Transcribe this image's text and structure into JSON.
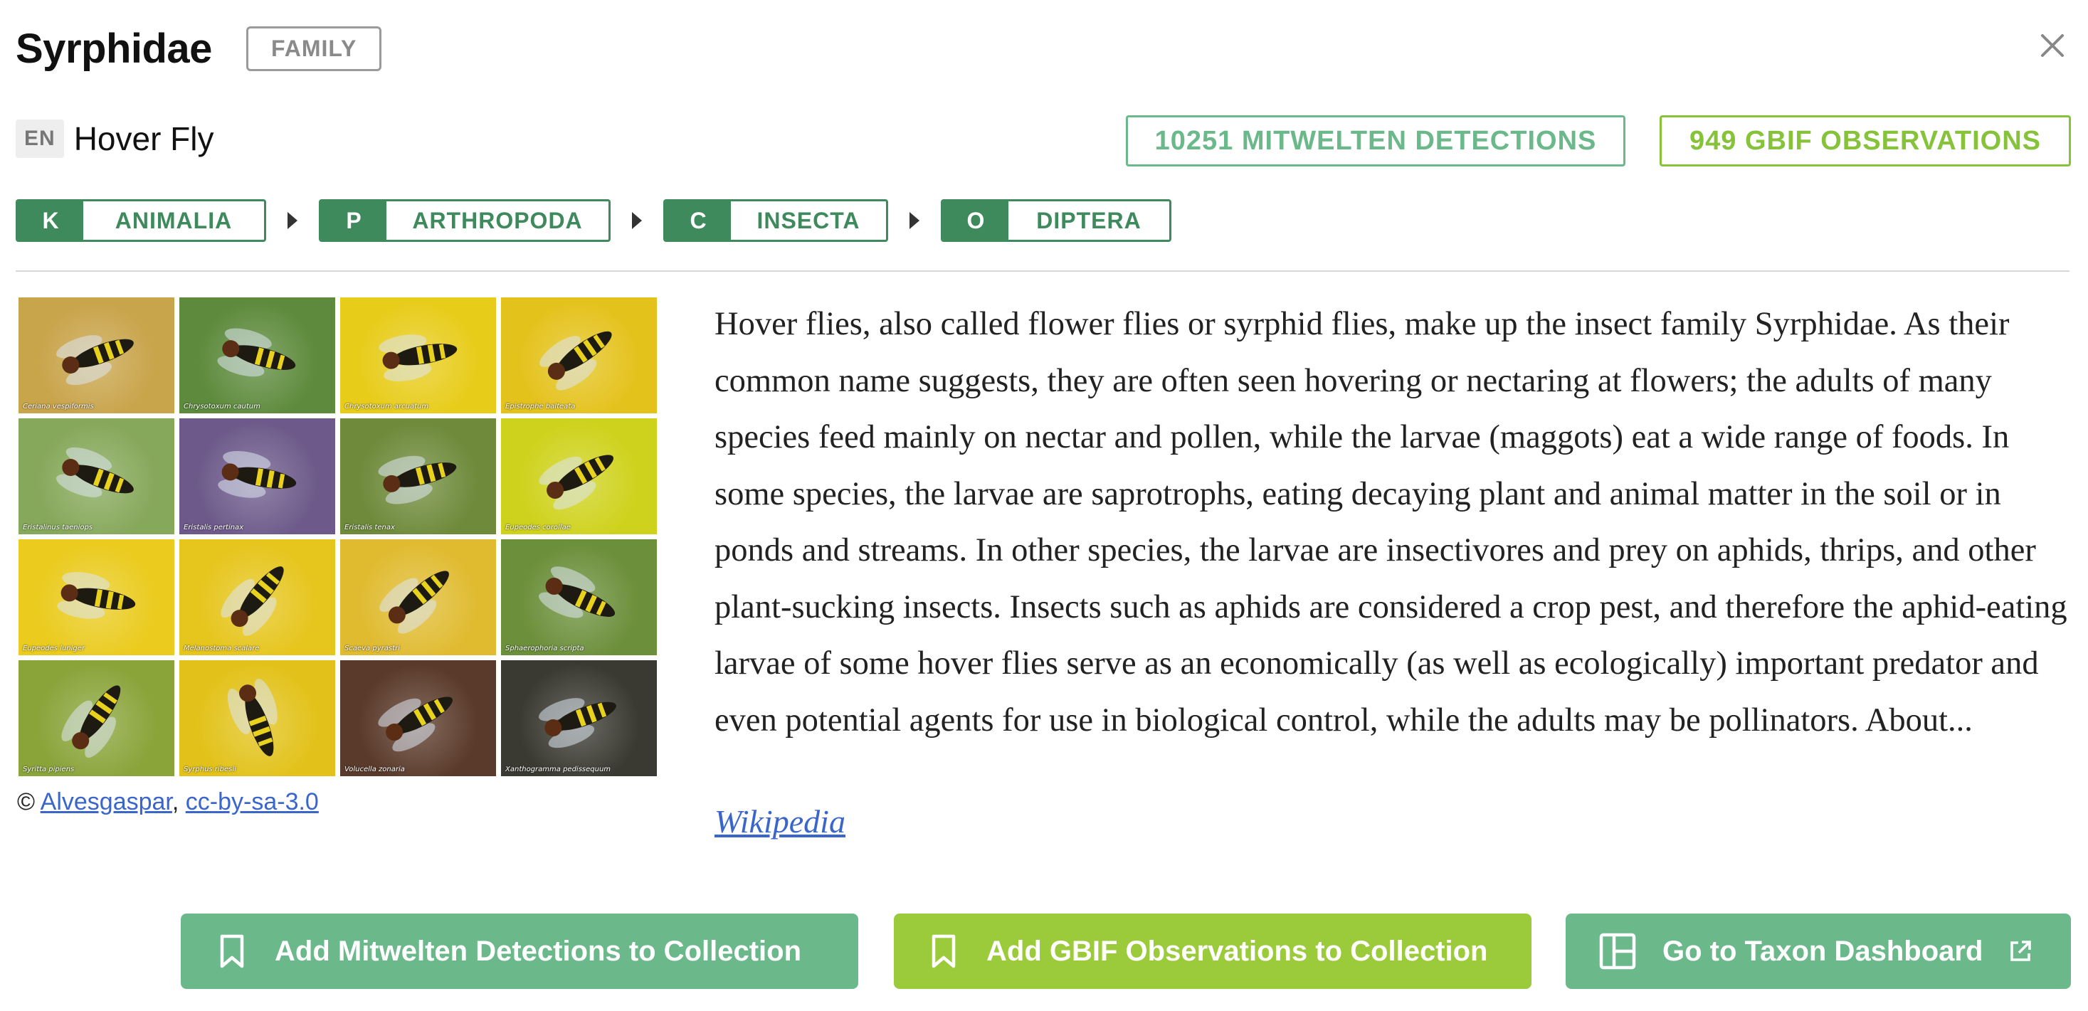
{
  "header": {
    "title": "Syrphidae",
    "rank": "FAMILY",
    "close_icon": "close-icon"
  },
  "common_name": {
    "lang": "EN",
    "name": "Hover Fly"
  },
  "counts": {
    "mitwelten": "10251 MITWELTEN DETECTIONS",
    "gbif": "949 GBIF OBSERVATIONS"
  },
  "taxonomy": [
    {
      "letter": "K",
      "name": "ANIMALIA"
    },
    {
      "letter": "P",
      "name": "ARTHROPODA"
    },
    {
      "letter": "C",
      "name": "INSECTA"
    },
    {
      "letter": "O",
      "name": "DIPTERA"
    }
  ],
  "gallery": [
    {
      "caption": "Ceriana vespiformis",
      "bg": "#c8a44a"
    },
    {
      "caption": "Chrysotoxum cautum",
      "bg": "#5d8a3c"
    },
    {
      "caption": "Chrysotoxum arcuatum",
      "bg": "#e8cc1a"
    },
    {
      "caption": "Epistrophe balteata",
      "bg": "#e4c21c"
    },
    {
      "caption": "Eristalinus taeniops",
      "bg": "#86a85a"
    },
    {
      "caption": "Eristalis pertinax",
      "bg": "#6d5a8a"
    },
    {
      "caption": "Eristalis tenax",
      "bg": "#6e8a3a"
    },
    {
      "caption": "Eupeodes corollae",
      "bg": "#cfd21c"
    },
    {
      "caption": "Eupeodes luniger",
      "bg": "#eacb1e"
    },
    {
      "caption": "Melanostoma scalare",
      "bg": "#e6c51c"
    },
    {
      "caption": "Scaeva pyrastri",
      "bg": "#e0bb30"
    },
    {
      "caption": "Sphaerophoria scripta",
      "bg": "#6b8f3a"
    },
    {
      "caption": "Syritta pipiens",
      "bg": "#8aa43a"
    },
    {
      "caption": "Syrphus ribesii",
      "bg": "#e2c21a"
    },
    {
      "caption": "Volucella zonaria",
      "bg": "#5a3a2a"
    },
    {
      "caption": "Xanthogramma pedissequum",
      "bg": "#3a3a32"
    }
  ],
  "credit": {
    "prefix": "©",
    "author": "Alvesgaspar",
    "license": "cc-by-sa-3.0",
    "comma": ","
  },
  "description": "Hover flies, also called flower flies or syrphid flies, make up the insect family Syrphidae. As their common name suggests, they are often seen hovering or nectaring at flowers; the adults of many species feed mainly on nectar and pollen, while the larvae (maggots) eat a wide range of foods. In some species, the larvae are saprotrophs, eating decaying plant and animal matter in the soil or in ponds and streams. In other species, the larvae are insectivores and prey on aphids, thrips, and other plant-sucking insects. Insects such as aphids are considered a crop pest, and therefore the aphid-eating larvae of some hover flies serve as an economically (as well as ecologically) important predator and even potential agents for use in biological control, while the adults may be pollinators. About...",
  "wiki_link": "Wikipedia",
  "actions": {
    "add_mitwelten": "Add Mitwelten Detections to Collection",
    "add_gbif": "Add GBIF Observations to Collection",
    "dashboard": "Go to Taxon Dashboard"
  },
  "colors": {
    "green": "#6bb98a",
    "lime": "#9bca3a",
    "dark_green": "#3f8a5c",
    "link": "#3a66cc"
  }
}
